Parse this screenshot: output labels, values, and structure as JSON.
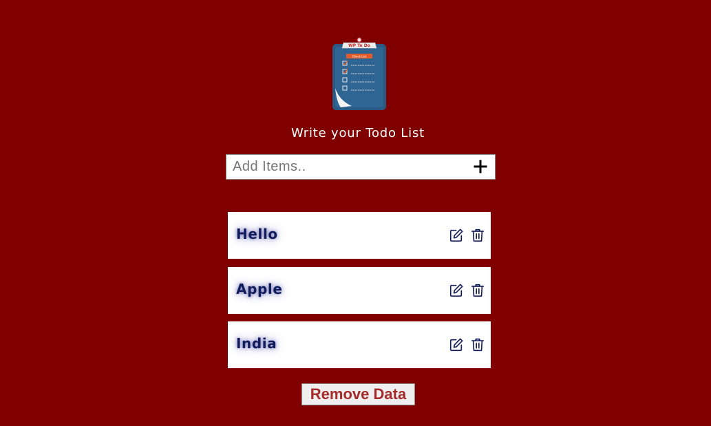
{
  "logo": {
    "header_text": "WP To Do",
    "banner_text": "Check List"
  },
  "subtitle": "Write your Todo List",
  "add_input": {
    "placeholder": "Add Items..",
    "value": ""
  },
  "items": [
    {
      "label": "Hello"
    },
    {
      "label": "Apple"
    },
    {
      "label": "India"
    }
  ],
  "remove_button_label": "Remove Data",
  "colors": {
    "background": "#800000",
    "item_text": "#111c5c",
    "remove_text": "#a52a2a"
  }
}
